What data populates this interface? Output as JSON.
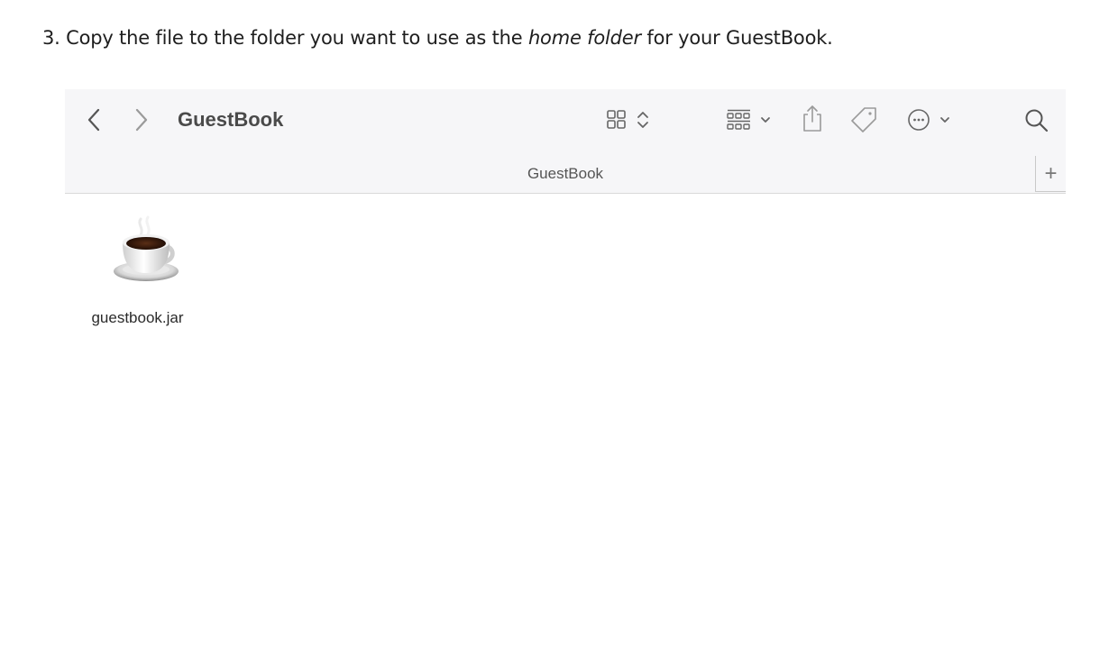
{
  "instruction": {
    "prefix": "3. Copy the file to the folder you want to use as the ",
    "emphasis": "home folder",
    "suffix": " for your GuestBook."
  },
  "window": {
    "title": "GuestBook",
    "tab_label": "GuestBook",
    "new_tab_glyph": "+"
  },
  "toolbar_icons": [
    "back-icon",
    "forward-icon",
    "icon-view-icon",
    "group-icon",
    "share-icon",
    "tag-icon",
    "more-actions-icon",
    "search-icon"
  ],
  "files": [
    {
      "name": "guestbook.jar",
      "icon": "java-coffee-cup-icon"
    }
  ]
}
